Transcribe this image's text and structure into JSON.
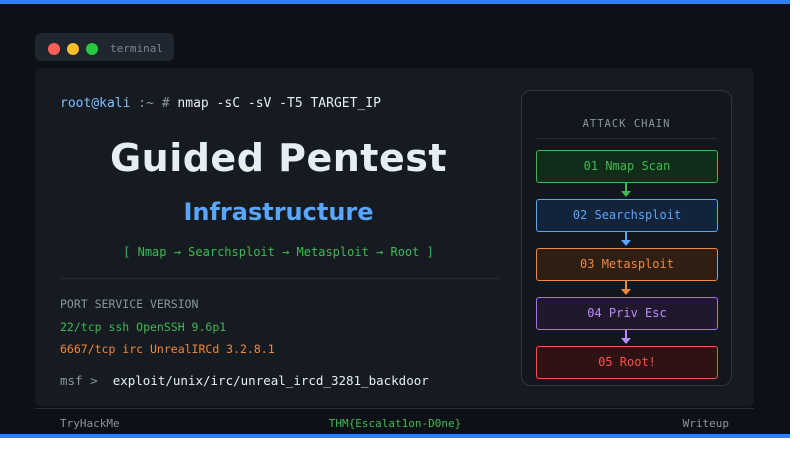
{
  "window": {
    "tab_label": "terminal"
  },
  "prompt": {
    "user": "root@kali",
    "path": ":~",
    "symbol": "#",
    "command": "nmap -sC -sV -T5 TARGET_IP"
  },
  "hero": {
    "title": "Guided Pentest",
    "subtitle": "Infrastructure",
    "chain_line": "[ Nmap → Searchsploit → Metasploit → Root ]"
  },
  "scan": {
    "header": "PORT SERVICE VERSION",
    "rows": [
      "22/tcp ssh OpenSSH 9.6p1",
      "6667/tcp irc UnrealIRCd 3.2.8.1"
    ]
  },
  "msf": {
    "prompt": "msf >",
    "command": "exploit/unix/irc/unreal_ircd_3281_backdoor"
  },
  "attack_chain": {
    "title": "ATTACK CHAIN",
    "steps": [
      "01 Nmap Scan",
      "02 Searchsploit",
      "03 Metasploit",
      "04 Priv Esc",
      "05 Root!"
    ]
  },
  "footer": {
    "left": "TryHackMe",
    "center": "THM{Escalat1on-D0ne}",
    "right": "Writeup"
  },
  "colors": {
    "accent_blue": "#2f81f7",
    "green": "#3fb950",
    "blue": "#58a6ff",
    "orange": "#f0883e",
    "purple": "#bc8cff",
    "red": "#f85149",
    "background": "#0d1117"
  }
}
